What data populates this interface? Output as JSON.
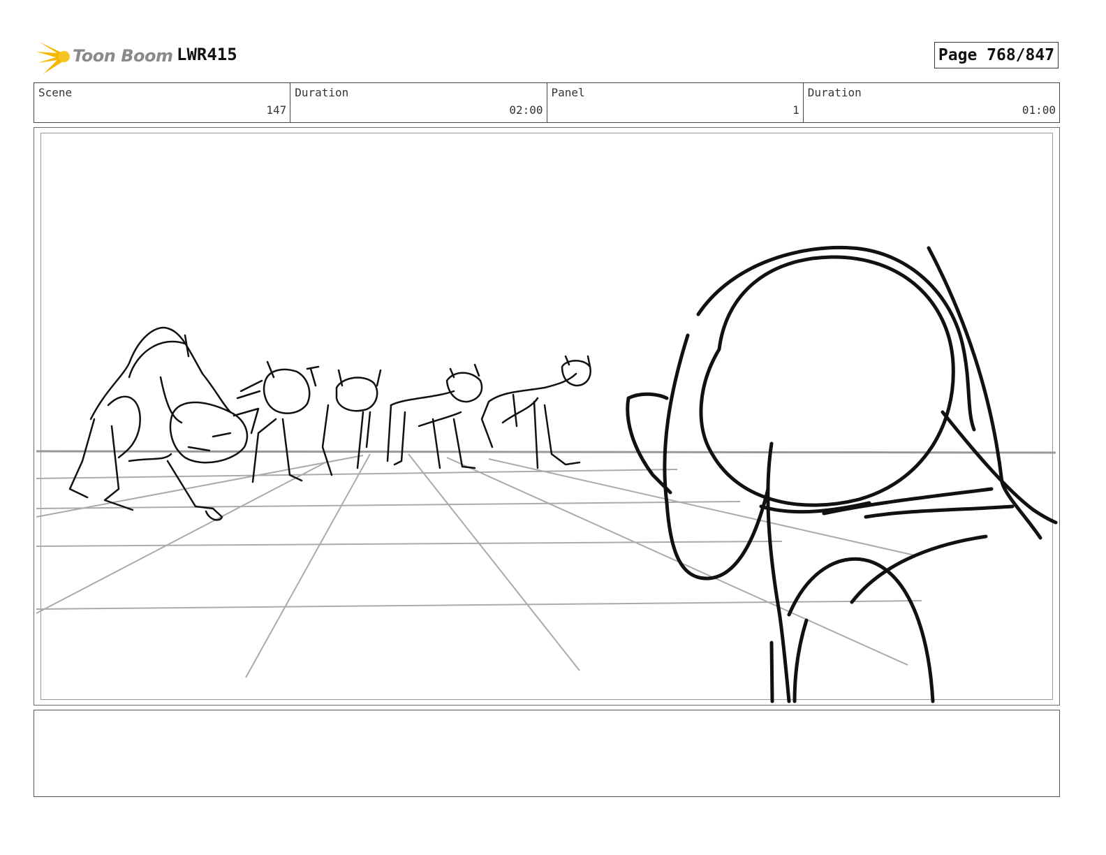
{
  "header": {
    "logo_text": "Toon Boom",
    "project": "LWR415",
    "page": "Page 768/847"
  },
  "info": {
    "scene_label": "Scene",
    "scene_value": "147",
    "scene_duration_label": "Duration",
    "scene_duration_value": "02:00",
    "panel_label": "Panel",
    "panel_value": "1",
    "panel_duration_label": "Duration",
    "panel_duration_value": "01:00"
  },
  "notes": {
    "text": ""
  },
  "colors": {
    "logo_accent": "#f5b800",
    "sketch_line": "#111111",
    "grid_line": "#aaaaaa"
  }
}
